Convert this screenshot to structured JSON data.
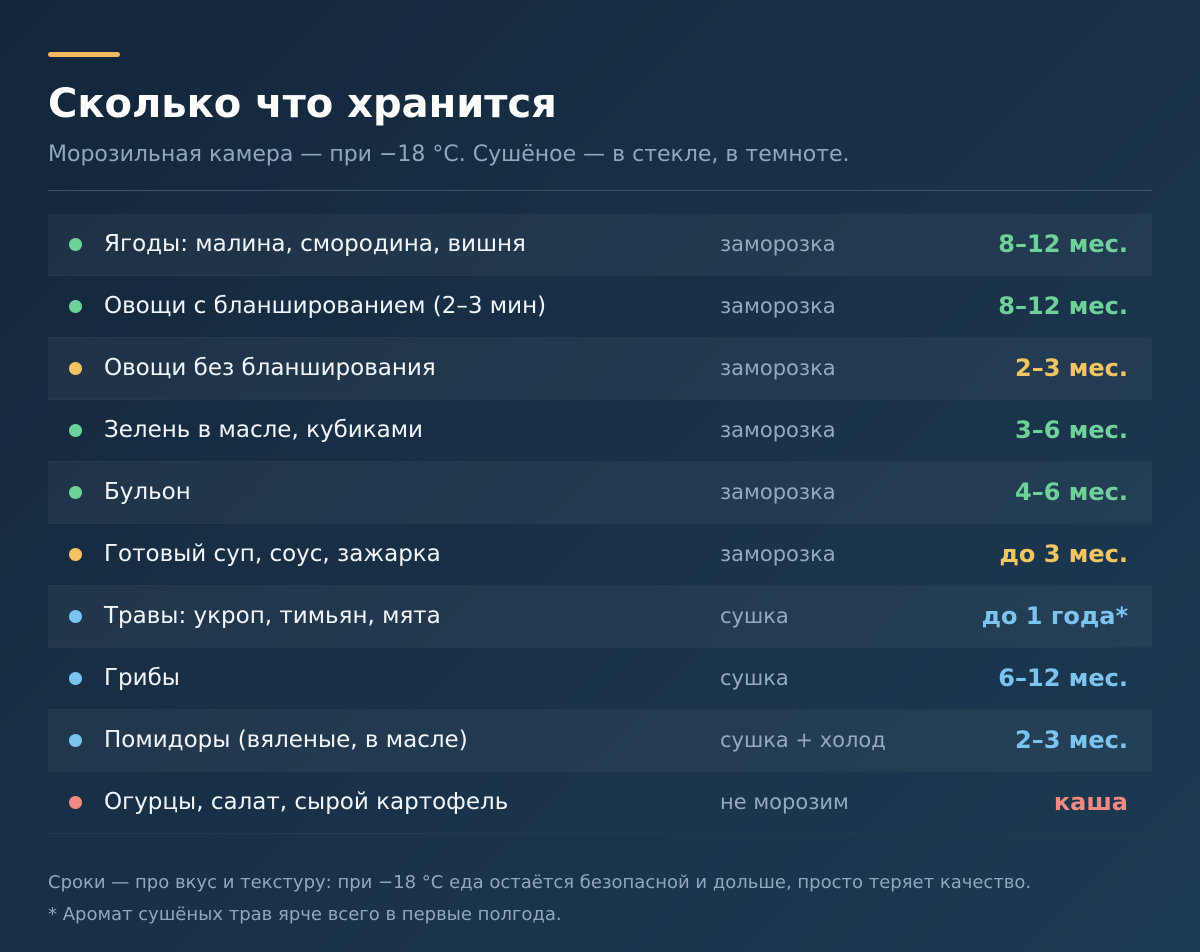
{
  "header": {
    "title": "Сколько что хранится",
    "subtitle": "Морозильная камера — при −18 °С. Сушёное — в стекле, в темноте."
  },
  "colors": {
    "accent": "#f4b860",
    "green": "#6fd19a",
    "yellow": "#f2c462",
    "blue": "#7cc4f0",
    "red": "#f08a80"
  },
  "rows": [
    {
      "name": "Ягоды: малина, смородина, вишня",
      "method": "заморозка",
      "duration": "8–12 мес.",
      "status": "green"
    },
    {
      "name": "Овощи с бланшированием (2–3 мин)",
      "method": "заморозка",
      "duration": "8–12 мес.",
      "status": "green"
    },
    {
      "name": "Овощи без бланширования",
      "method": "заморозка",
      "duration": "2–3 мес.",
      "status": "yellow"
    },
    {
      "name": "Зелень в масле, кубиками",
      "method": "заморозка",
      "duration": "3–6 мес.",
      "status": "green"
    },
    {
      "name": "Бульон",
      "method": "заморозка",
      "duration": "4–6 мес.",
      "status": "green"
    },
    {
      "name": "Готовый суп, соус, зажарка",
      "method": "заморозка",
      "duration": "до 3 мес.",
      "status": "yellow"
    },
    {
      "name": "Травы: укроп, тимьян, мята",
      "method": "сушка",
      "duration": "до 1 года*",
      "status": "blue"
    },
    {
      "name": "Грибы",
      "method": "сушка",
      "duration": "6–12 мес.",
      "status": "blue"
    },
    {
      "name": "Помидоры (вяленые, в масле)",
      "method": "сушка + холод",
      "duration": "2–3 мес.",
      "status": "blue"
    },
    {
      "name": "Огурцы, салат, сырой картофель",
      "method": "не морозим",
      "duration": "каша",
      "status": "red"
    }
  ],
  "footnotes": {
    "note1": "Сроки — про вкус и текстуру: при −18 °С еда остаётся безопасной и дольше, просто теряет качество.",
    "note2": "* Аромат сушёных трав ярче всего в первые полгода."
  }
}
